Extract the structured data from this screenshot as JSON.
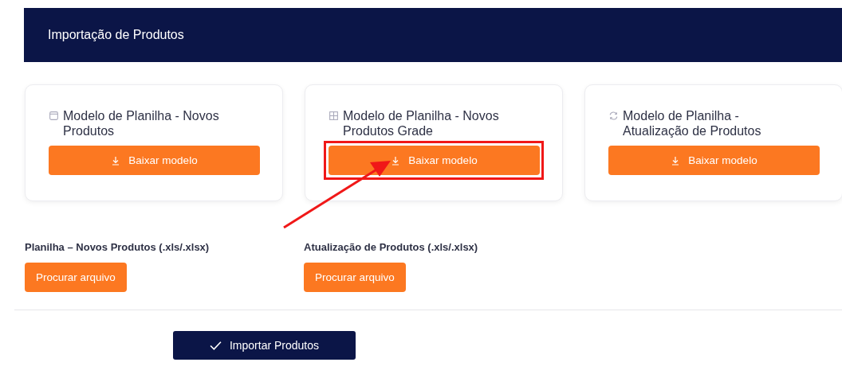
{
  "header": {
    "title": "Importação de Produtos"
  },
  "templates": [
    {
      "kind": "new",
      "title": "Modelo de Planilha - Novos Produtos",
      "button": "Baixar modelo",
      "highlighted": false
    },
    {
      "kind": "grid",
      "title": "Modelo de Planilha - Novos Produtos Grade",
      "button": "Baixar modelo",
      "highlighted": true
    },
    {
      "kind": "update",
      "title": "Modelo de Planilha - Atualização de Produtos",
      "button": "Baixar modelo",
      "highlighted": false
    }
  ],
  "uploads": [
    {
      "label": "Planilha – Novos Produtos (.xls/.xlsx)",
      "button": "Procurar arquivo"
    },
    {
      "label": "Atualização de Produtos (.xls/.xlsx)",
      "button": "Procurar arquivo"
    }
  ],
  "submit": {
    "label": "Importar Produtos"
  }
}
